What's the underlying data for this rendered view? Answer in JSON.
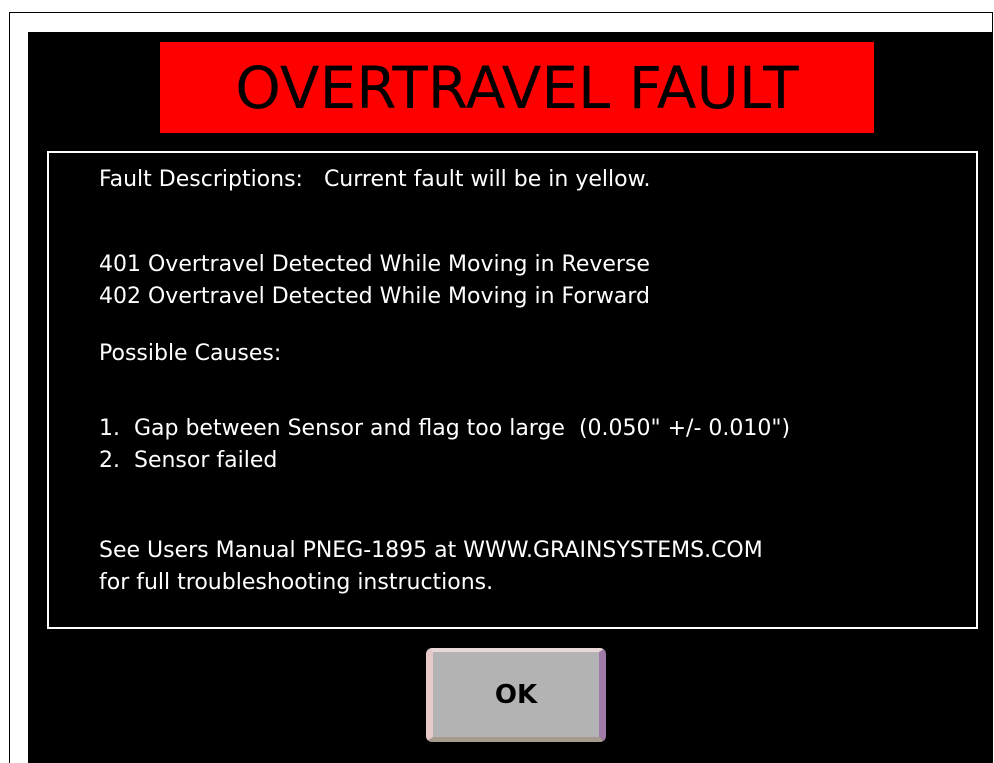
{
  "title": {
    "text": "OVERTRAVEL FAULT",
    "background_color": "#ff0000",
    "text_color": "#000000"
  },
  "panel": {
    "header": "Fault Descriptions:   Current fault will be in yellow.",
    "faults": [
      "401 Overtravel Detected While Moving in Reverse",
      "402 Overtravel Detected While Moving in Forward"
    ],
    "causes_heading": "Possible Causes:",
    "causes": [
      "1.  Gap between Sensor and flag too large  (0.050\" +/- 0.010\")",
      "2.  Sensor failed"
    ],
    "footer_lines": [
      "See Users Manual PNEG-1895 at WWW.GRAINSYSTEMS.COM",
      "for full troubleshooting instructions."
    ],
    "current_fault_color": "#ffff00",
    "text_color": "#ffffff"
  },
  "ok_button": {
    "label": "OK"
  }
}
